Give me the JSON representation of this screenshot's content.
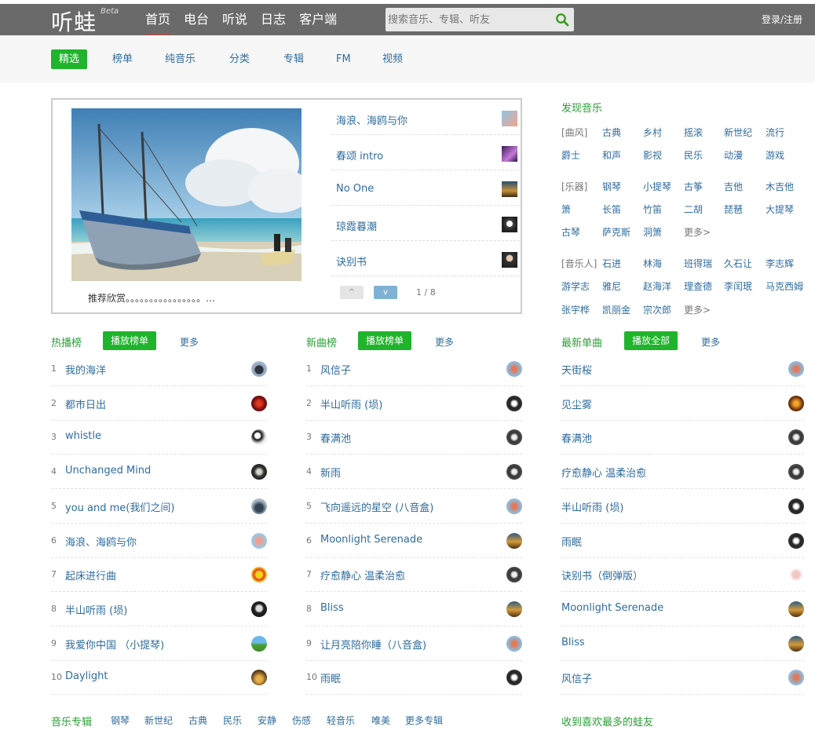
{
  "header": {
    "logo": "听蛙",
    "beta": "Beta",
    "nav": [
      "首页",
      "电台",
      "听说",
      "日志",
      "客户端"
    ],
    "search_placeholder": "搜索音乐、专辑、听友",
    "login": "登录/注册"
  },
  "subnav": [
    "精选",
    "榜单",
    "纯音乐",
    "分类",
    "专辑",
    "FM",
    "视频"
  ],
  "carousel": {
    "caption": "推荐欣赏。。。。。。。。。。。。。。。。…",
    "items": [
      "海浪、海鸥与你",
      "春颂 intro",
      "No One",
      "琼霞暮潮",
      "诀别书"
    ],
    "prev": "^",
    "next": "v",
    "pager": "1 / 8"
  },
  "discover": {
    "title": "发现音乐",
    "style_label": "[曲风]",
    "styles_row1": [
      "古典",
      "乡村",
      "摇滚",
      "新世纪",
      "流行"
    ],
    "styles_row2": [
      "爵士",
      "和声",
      "影视",
      "民乐",
      "动漫",
      "游戏"
    ],
    "inst_label": "[乐器]",
    "inst_row1": [
      "钢琴",
      "小提琴",
      "古筝",
      "吉他",
      "木吉他"
    ],
    "inst_row2": [
      "箫",
      "长笛",
      "竹笛",
      "二胡",
      "琵琶",
      "大提琴"
    ],
    "inst_row3": [
      "古琴",
      "萨克斯",
      "洞箫",
      "更多>"
    ],
    "artist_label": "[音乐人]",
    "artist_row1": [
      "石进",
      "林海",
      "班得瑞",
      "久石让",
      "李志辉"
    ],
    "artist_row2": [
      "游学志",
      "雅尼",
      "赵海洋",
      "理查德",
      "李闰珉",
      "马克西姆"
    ],
    "artist_row3": [
      "张宇桦",
      "凯丽金",
      "宗次郎",
      "更多>"
    ]
  },
  "hot": {
    "title": "热播榜",
    "play": "播放榜单",
    "more": "更多",
    "songs": [
      "我的海洋",
      "都市日出",
      "whistle",
      "Unchanged Mind",
      "you and me(我们之间)",
      "海浪、海鸥与你",
      "起床进行曲",
      "半山听雨 (埙)",
      "我爱你中国 （小提琴)",
      "Daylight"
    ]
  },
  "new": {
    "title": "新曲榜",
    "play": "播放榜单",
    "more": "更多",
    "songs": [
      "风信子",
      "半山听雨 (埙)",
      "春满池",
      "新雨",
      "飞向遥远的星空 (八音盒)",
      "Moonlight Serenade",
      "疗愈静心 温柔治愈",
      "Bliss",
      "让月亮陪你睡（八音盒)",
      "雨眠"
    ]
  },
  "latest": {
    "title": "最新单曲",
    "play": "播放全部",
    "more": "更多",
    "songs": [
      "天街桜",
      "见尘雾",
      "春满池",
      "疗愈静心 温柔治愈",
      "半山听雨 (埙)",
      "雨眠",
      "诀别书（倒弹版）",
      "Moonlight Serenade",
      "Bliss",
      "风信子"
    ]
  },
  "numbers": [
    "1",
    "2",
    "3",
    "4",
    "5",
    "6",
    "7",
    "8",
    "9",
    "10"
  ],
  "bottom": {
    "albums_title": "音乐专辑",
    "album_tags": [
      "钢琴",
      "新世纪",
      "古典",
      "民乐",
      "安静",
      "伤感",
      "轻音乐",
      "唯美",
      "更多专辑"
    ],
    "fans_title": "收到喜欢最多的蛙友"
  },
  "colors": {
    "accent_green": "#1fb42b",
    "link_blue": "#2f6c9e",
    "topbar": "#6a6a6a"
  }
}
